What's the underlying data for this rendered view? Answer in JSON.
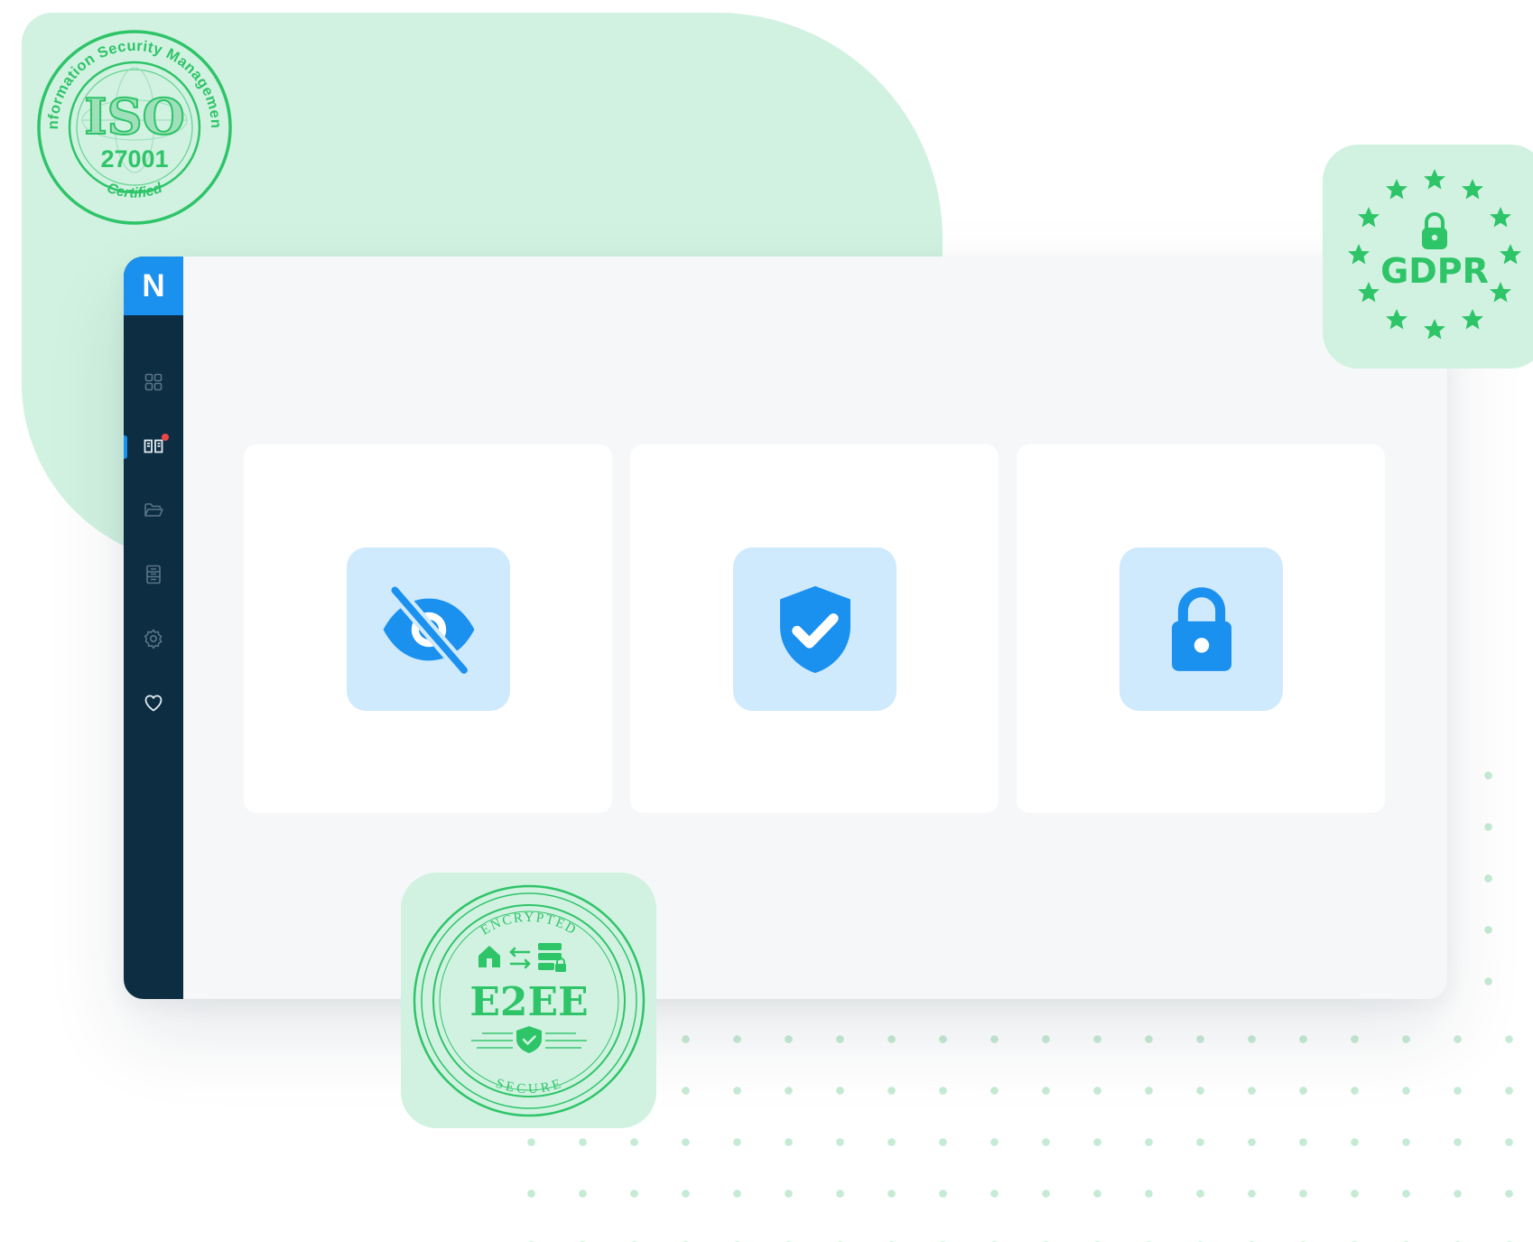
{
  "app": {
    "logo_letter": "N"
  },
  "sidebar": {
    "items": [
      {
        "icon": "grid-icon",
        "active": false,
        "notification": false
      },
      {
        "icon": "book-icon",
        "active": true,
        "notification": true
      },
      {
        "icon": "folder-icon",
        "active": false,
        "notification": false
      },
      {
        "icon": "document-icon",
        "active": false,
        "notification": false
      },
      {
        "icon": "settings-icon",
        "active": false,
        "notification": false
      },
      {
        "icon": "heart-icon",
        "active": false,
        "notification": false
      }
    ]
  },
  "feature_cards": [
    {
      "icon": "eye-off-icon"
    },
    {
      "icon": "shield-check-icon"
    },
    {
      "icon": "lock-icon"
    }
  ],
  "badges": {
    "iso": {
      "main": "ISO",
      "number": "27001",
      "ring_text": "Information Security Management",
      "bottom_text": "Certified"
    },
    "gdpr": {
      "label": "GDPR"
    },
    "e2ee": {
      "main": "E2EE",
      "top_text": "ENCRYPTED",
      "bottom_text": "SECURE"
    }
  },
  "colors": {
    "primary_blue": "#1a90ef",
    "light_blue_tile": "#cfe9fd",
    "sidebar_navy": "#0c2d42",
    "mint_background": "#d1f2e1",
    "badge_green": "#2ec468",
    "notification_red": "#f04545"
  }
}
